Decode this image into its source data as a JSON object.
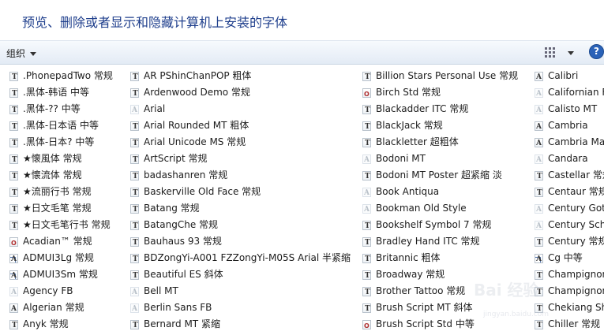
{
  "header": {
    "title": "预览、删除或者显示和隐藏计算机上安装的字体"
  },
  "toolbar": {
    "organize_label": "组织",
    "help_label": "?"
  },
  "watermark": {
    "text": "Bai 经验",
    "sub": "jingyan.baidu.com"
  },
  "columns": [
    {
      "items": [
        {
          "label": ".PhonepadTwo 常规",
          "icon": "t"
        },
        {
          "label": ".黑体-韩语 中等",
          "icon": "t"
        },
        {
          "label": ".黑体-?? 中等",
          "icon": "t"
        },
        {
          "label": ".黑体-日本语 中等",
          "icon": "t"
        },
        {
          "label": ".黑体-日本? 中等",
          "icon": "t"
        },
        {
          "label": "★懐風体 常规",
          "icon": "t"
        },
        {
          "label": "★懐流体 常规",
          "icon": "t"
        },
        {
          "label": "★流丽行书 常规",
          "icon": "t"
        },
        {
          "label": "★日文毛笔 常规",
          "icon": "t"
        },
        {
          "label": "★日文毛笔行书 常规",
          "icon": "t"
        },
        {
          "label": "Acadian™ 常规",
          "icon": "o"
        },
        {
          "label": "ADMUI3Lg 常规",
          "icon": "link"
        },
        {
          "label": "ADMUI3Sm 常规",
          "icon": "link"
        },
        {
          "label": "Agency FB",
          "icon": "ghost"
        },
        {
          "label": "Algerian 常规",
          "icon": "a"
        },
        {
          "label": "Anyk 常规",
          "icon": "t"
        }
      ]
    },
    {
      "items": [
        {
          "label": "AR PShinChanPOP 粗体",
          "icon": "t"
        },
        {
          "label": "Ardenwood Demo 常规",
          "icon": "t"
        },
        {
          "label": "Arial",
          "icon": "ghost"
        },
        {
          "label": "Arial Rounded MT 粗体",
          "icon": "t"
        },
        {
          "label": "Arial Unicode MS 常规",
          "icon": "t"
        },
        {
          "label": "ArtScript 常规",
          "icon": "t"
        },
        {
          "label": "badashanren 常规",
          "icon": "t"
        },
        {
          "label": "Baskerville Old Face 常规",
          "icon": "t"
        },
        {
          "label": "Batang 常规",
          "icon": "t"
        },
        {
          "label": "BatangChe 常规",
          "icon": "t"
        },
        {
          "label": "Bauhaus 93 常规",
          "icon": "t"
        },
        {
          "label": "BDZongYi-A001 FZZongYi-M05S Arial 半紧缩",
          "icon": "t"
        },
        {
          "label": "Beautiful ES 斜体",
          "icon": "t"
        },
        {
          "label": "Bell MT",
          "icon": "ghost"
        },
        {
          "label": "Berlin Sans FB",
          "icon": "ghost"
        },
        {
          "label": "Bernard MT 紧缩",
          "icon": "t"
        }
      ]
    },
    {
      "items": [
        {
          "label": "Billion Stars Personal Use  常规",
          "icon": "t"
        },
        {
          "label": "Birch Std 常规",
          "icon": "o"
        },
        {
          "label": "Blackadder ITC 常规",
          "icon": "t"
        },
        {
          "label": "BlackJack 常规",
          "icon": "t"
        },
        {
          "label": "Blackletter 超粗体",
          "icon": "t"
        },
        {
          "label": "Bodoni MT",
          "icon": "ghost"
        },
        {
          "label": "Bodoni MT Poster 超紧缩 淡",
          "icon": "t"
        },
        {
          "label": "Book Antiqua",
          "icon": "ghost"
        },
        {
          "label": "Bookman Old Style",
          "icon": "ghost"
        },
        {
          "label": "Bookshelf Symbol 7 常规",
          "icon": "t"
        },
        {
          "label": "Bradley Hand ITC 常规",
          "icon": "t"
        },
        {
          "label": "Britannic 粗体",
          "icon": "t"
        },
        {
          "label": "Broadway 常规",
          "icon": "t"
        },
        {
          "label": "Brother Tattoo 常规",
          "icon": "t"
        },
        {
          "label": "Brush Script MT 斜体",
          "icon": "t"
        },
        {
          "label": "Brush Script Std 中等",
          "icon": "o"
        }
      ]
    },
    {
      "items": [
        {
          "label": "Calibri",
          "icon": "a"
        },
        {
          "label": "Californian FB",
          "icon": "ghost"
        },
        {
          "label": "Calisto MT",
          "icon": "ghost"
        },
        {
          "label": "Cambria",
          "icon": "a"
        },
        {
          "label": "Cambria Math",
          "icon": "a"
        },
        {
          "label": "Candara",
          "icon": "ghost"
        },
        {
          "label": "Castellar 常规",
          "icon": "t"
        },
        {
          "label": "Centaur 常规",
          "icon": "t"
        },
        {
          "label": "Century Gothic",
          "icon": "ghost"
        },
        {
          "label": "Century Schoolbook",
          "icon": "ghost"
        },
        {
          "label": "Century 常规",
          "icon": "t"
        },
        {
          "label": "Cg 中等",
          "icon": "link"
        },
        {
          "label": "Champignon",
          "icon": "t"
        },
        {
          "label": "Champignon",
          "icon": "t"
        },
        {
          "label": "Chekiang Shu",
          "icon": "t"
        },
        {
          "label": "Chiller 常规",
          "icon": "t"
        }
      ]
    }
  ]
}
